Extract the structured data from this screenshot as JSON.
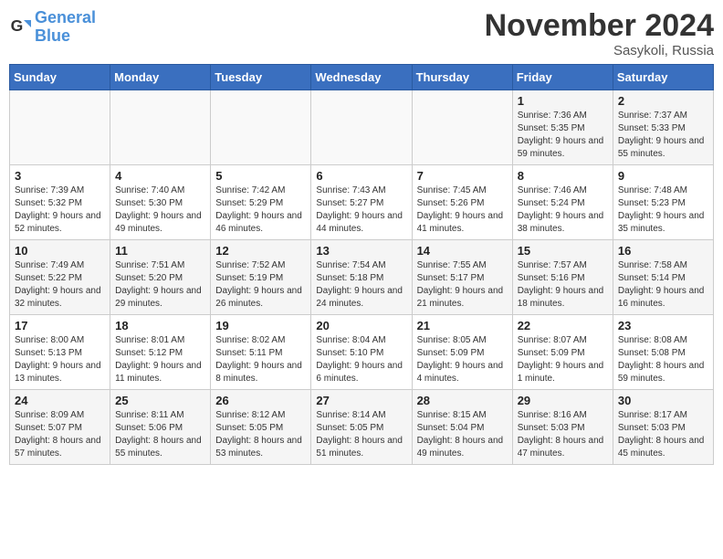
{
  "logo": {
    "line1": "General",
    "line2": "Blue"
  },
  "title": "November 2024",
  "location": "Sasykoli, Russia",
  "days_header": [
    "Sunday",
    "Monday",
    "Tuesday",
    "Wednesday",
    "Thursday",
    "Friday",
    "Saturday"
  ],
  "weeks": [
    [
      {
        "day": "",
        "info": ""
      },
      {
        "day": "",
        "info": ""
      },
      {
        "day": "",
        "info": ""
      },
      {
        "day": "",
        "info": ""
      },
      {
        "day": "",
        "info": ""
      },
      {
        "day": "1",
        "info": "Sunrise: 7:36 AM\nSunset: 5:35 PM\nDaylight: 9 hours and 59 minutes."
      },
      {
        "day": "2",
        "info": "Sunrise: 7:37 AM\nSunset: 5:33 PM\nDaylight: 9 hours and 55 minutes."
      }
    ],
    [
      {
        "day": "3",
        "info": "Sunrise: 7:39 AM\nSunset: 5:32 PM\nDaylight: 9 hours and 52 minutes."
      },
      {
        "day": "4",
        "info": "Sunrise: 7:40 AM\nSunset: 5:30 PM\nDaylight: 9 hours and 49 minutes."
      },
      {
        "day": "5",
        "info": "Sunrise: 7:42 AM\nSunset: 5:29 PM\nDaylight: 9 hours and 46 minutes."
      },
      {
        "day": "6",
        "info": "Sunrise: 7:43 AM\nSunset: 5:27 PM\nDaylight: 9 hours and 44 minutes."
      },
      {
        "day": "7",
        "info": "Sunrise: 7:45 AM\nSunset: 5:26 PM\nDaylight: 9 hours and 41 minutes."
      },
      {
        "day": "8",
        "info": "Sunrise: 7:46 AM\nSunset: 5:24 PM\nDaylight: 9 hours and 38 minutes."
      },
      {
        "day": "9",
        "info": "Sunrise: 7:48 AM\nSunset: 5:23 PM\nDaylight: 9 hours and 35 minutes."
      }
    ],
    [
      {
        "day": "10",
        "info": "Sunrise: 7:49 AM\nSunset: 5:22 PM\nDaylight: 9 hours and 32 minutes."
      },
      {
        "day": "11",
        "info": "Sunrise: 7:51 AM\nSunset: 5:20 PM\nDaylight: 9 hours and 29 minutes."
      },
      {
        "day": "12",
        "info": "Sunrise: 7:52 AM\nSunset: 5:19 PM\nDaylight: 9 hours and 26 minutes."
      },
      {
        "day": "13",
        "info": "Sunrise: 7:54 AM\nSunset: 5:18 PM\nDaylight: 9 hours and 24 minutes."
      },
      {
        "day": "14",
        "info": "Sunrise: 7:55 AM\nSunset: 5:17 PM\nDaylight: 9 hours and 21 minutes."
      },
      {
        "day": "15",
        "info": "Sunrise: 7:57 AM\nSunset: 5:16 PM\nDaylight: 9 hours and 18 minutes."
      },
      {
        "day": "16",
        "info": "Sunrise: 7:58 AM\nSunset: 5:14 PM\nDaylight: 9 hours and 16 minutes."
      }
    ],
    [
      {
        "day": "17",
        "info": "Sunrise: 8:00 AM\nSunset: 5:13 PM\nDaylight: 9 hours and 13 minutes."
      },
      {
        "day": "18",
        "info": "Sunrise: 8:01 AM\nSunset: 5:12 PM\nDaylight: 9 hours and 11 minutes."
      },
      {
        "day": "19",
        "info": "Sunrise: 8:02 AM\nSunset: 5:11 PM\nDaylight: 9 hours and 8 minutes."
      },
      {
        "day": "20",
        "info": "Sunrise: 8:04 AM\nSunset: 5:10 PM\nDaylight: 9 hours and 6 minutes."
      },
      {
        "day": "21",
        "info": "Sunrise: 8:05 AM\nSunset: 5:09 PM\nDaylight: 9 hours and 4 minutes."
      },
      {
        "day": "22",
        "info": "Sunrise: 8:07 AM\nSunset: 5:09 PM\nDaylight: 9 hours and 1 minute."
      },
      {
        "day": "23",
        "info": "Sunrise: 8:08 AM\nSunset: 5:08 PM\nDaylight: 8 hours and 59 minutes."
      }
    ],
    [
      {
        "day": "24",
        "info": "Sunrise: 8:09 AM\nSunset: 5:07 PM\nDaylight: 8 hours and 57 minutes."
      },
      {
        "day": "25",
        "info": "Sunrise: 8:11 AM\nSunset: 5:06 PM\nDaylight: 8 hours and 55 minutes."
      },
      {
        "day": "26",
        "info": "Sunrise: 8:12 AM\nSunset: 5:05 PM\nDaylight: 8 hours and 53 minutes."
      },
      {
        "day": "27",
        "info": "Sunrise: 8:14 AM\nSunset: 5:05 PM\nDaylight: 8 hours and 51 minutes."
      },
      {
        "day": "28",
        "info": "Sunrise: 8:15 AM\nSunset: 5:04 PM\nDaylight: 8 hours and 49 minutes."
      },
      {
        "day": "29",
        "info": "Sunrise: 8:16 AM\nSunset: 5:03 PM\nDaylight: 8 hours and 47 minutes."
      },
      {
        "day": "30",
        "info": "Sunrise: 8:17 AM\nSunset: 5:03 PM\nDaylight: 8 hours and 45 minutes."
      }
    ]
  ]
}
